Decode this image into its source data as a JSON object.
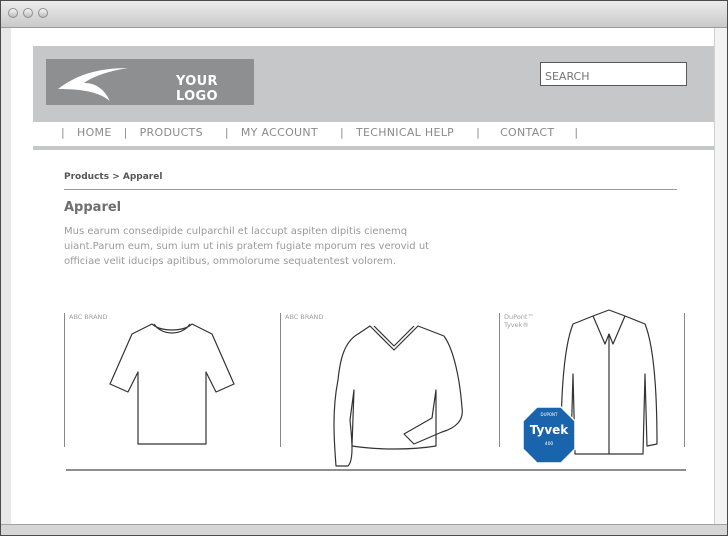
{
  "header": {
    "logo_text": "YOUR LOGO",
    "search_placeholder": "SEARCH"
  },
  "nav": {
    "items": [
      "HOME",
      "PRODUCTS",
      "MY ACCOUNT",
      "TECHNICAL HELP",
      "CONTACT"
    ]
  },
  "breadcrumb": "Products > Apparel",
  "page": {
    "title": "Apparel",
    "description": "Mus earum consedipide culparchil et laccupt aspiten dipitis cienemq uiant.Parum eum, sum ium ut inis pratem fugiate mporum res verovid ut officiae velit iducips apitibus, ommolorume sequatentest volorem."
  },
  "products": [
    {
      "brand": "ABC BRAND",
      "item": "t-shirt"
    },
    {
      "brand": "ABC BRAND",
      "item": "v-neck sweater"
    },
    {
      "brand_line1": "DuPont™",
      "brand_line2": "Tyvek®",
      "item": "lab coat",
      "badge": {
        "top": "DUPONT",
        "name": "Tyvek",
        "sub": "400",
        "color": "#1a63ad"
      }
    }
  ]
}
